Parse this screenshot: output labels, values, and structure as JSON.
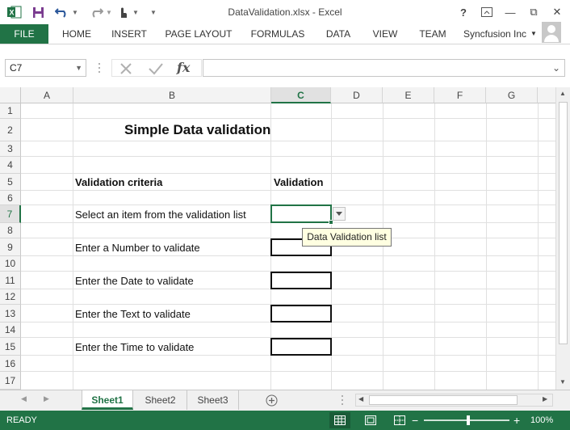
{
  "window": {
    "title": "DataValidation.xlsx - Excel",
    "help": "?",
    "minimize": "—",
    "restore": "⧉",
    "close": "✕"
  },
  "ribbon": {
    "tabs": [
      "FILE",
      "HOME",
      "INSERT",
      "PAGE LAYOUT",
      "FORMULAS",
      "DATA",
      "VIEW",
      "TEAM"
    ],
    "account": "Syncfusion Inc"
  },
  "formula_bar": {
    "name_box": "C7",
    "fx": "fx",
    "value": ""
  },
  "columns": [
    "A",
    "B",
    "C",
    "D",
    "E",
    "F",
    "G"
  ],
  "selected_column": "C",
  "rows": [
    "1",
    "2",
    "3",
    "4",
    "5",
    "6",
    "7",
    "8",
    "9",
    "10",
    "11",
    "12",
    "13",
    "14",
    "15",
    "16",
    "17"
  ],
  "selected_row": "7",
  "cells": {
    "title": "Simple Data validation",
    "header_criteria": "Validation criteria",
    "header_validation": "Validation",
    "r7": "Select an item from the validation list",
    "r9": "Enter a Number to validate",
    "r11": "Enter the Date to validate",
    "r13": "Enter the Text to validate",
    "r15": "Enter the Time to validate"
  },
  "tooltip": "Data Validation list",
  "sheets": [
    "Sheet1",
    "Sheet2",
    "Sheet3"
  ],
  "active_sheet": "Sheet1",
  "status": {
    "text": "READY",
    "zoom": "100%",
    "zoom_minus": "−",
    "zoom_plus": "+"
  },
  "colors": {
    "accent": "#217346",
    "tooltip_bg": "#ffffe1"
  }
}
